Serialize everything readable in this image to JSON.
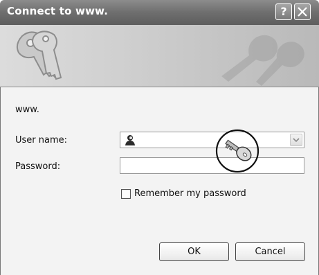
{
  "window": {
    "title": "Connect to www.",
    "help_label": "?"
  },
  "form": {
    "site_text": "www.",
    "username_label": "User name:",
    "username_value": "",
    "password_label": "Password:",
    "password_value": "",
    "remember_label": "Remember my password",
    "remember_checked": false
  },
  "buttons": {
    "ok_label": "OK",
    "cancel_label": "Cancel"
  },
  "icons": {
    "banner": "keys-icon",
    "user": "user-icon",
    "callout": "key-icon",
    "dropdown": "chevron-down-icon",
    "close": "close-icon"
  }
}
